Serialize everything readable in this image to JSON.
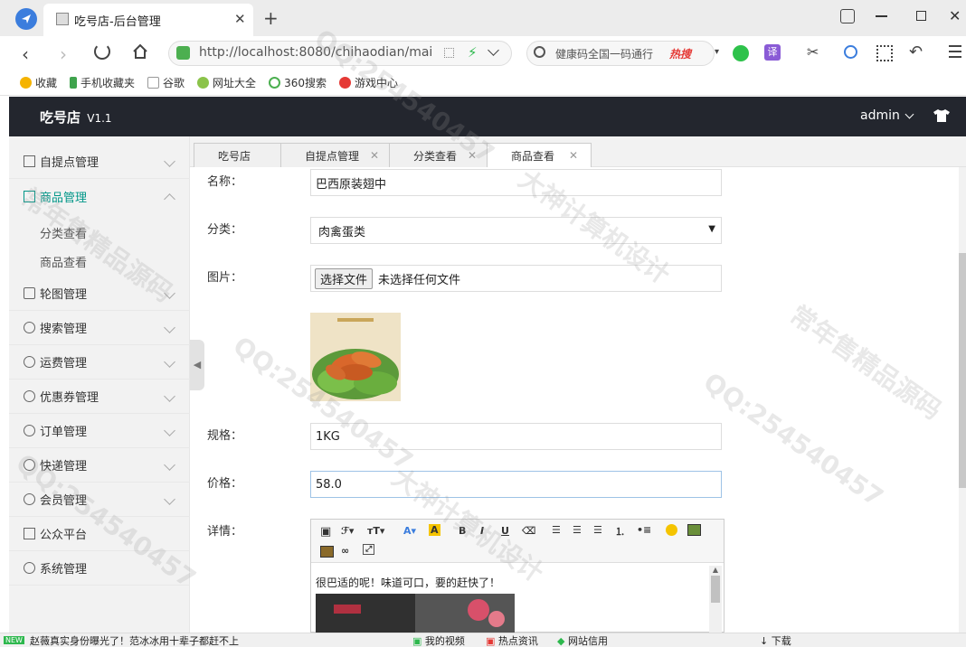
{
  "browser": {
    "tab_title": "吃号店-后台管理",
    "url": "http://localhost:8080/chihaodian/mair",
    "url_host_bold": "localhost",
    "search_placeholder": "健康码全国一码通行",
    "search_hot": "热搜",
    "bookmarks": [
      "收藏",
      "手机收藏夹",
      "谷歌",
      "网址大全",
      "360搜索",
      "游戏中心"
    ]
  },
  "app": {
    "logo": "吃号店",
    "version": "V1.1",
    "user": "admin"
  },
  "sidebar": {
    "items": [
      {
        "label": "自提点管理"
      },
      {
        "label": "商品管理"
      },
      {
        "label": "轮图管理"
      },
      {
        "label": "搜索管理"
      },
      {
        "label": "运费管理"
      },
      {
        "label": "优惠券管理"
      },
      {
        "label": "订单管理"
      },
      {
        "label": "快递管理"
      },
      {
        "label": "会员管理"
      },
      {
        "label": "公众平台"
      },
      {
        "label": "系统管理"
      }
    ],
    "sub_items": [
      "分类查看",
      "商品查看"
    ]
  },
  "page_tabs": [
    "吃号店",
    "自提点管理",
    "分类查看",
    "商品查看"
  ],
  "form": {
    "name_label": "名称：",
    "name_value": "巴西原装翅中",
    "category_label": "分类：",
    "category_value": "肉禽蛋类",
    "image_label": "图片：",
    "file_button": "选择文件",
    "file_status": "未选择任何文件",
    "spec_label": "规格：",
    "spec_value": "1KG",
    "price_label": "价格：",
    "price_value": "58.0",
    "detail_label": "详情：",
    "detail_text": "很巴适的呢！味道可口，要的赶快了！"
  },
  "statusbar": {
    "news_badge": "NEW",
    "news": "赵薇真实身份曝光了！范冰冰用十辈子都赶不上",
    "my_video": "我的视频",
    "hot_news": "热点资讯",
    "site_trust": "网站信用",
    "download": "下载"
  },
  "watermark": {
    "lines": [
      "QQ:254540457",
      "大神计算机设计",
      "常年售精品源码"
    ]
  },
  "colors": {
    "header_bg": "#23262e",
    "sidebar_active": "#009688",
    "sidebar_bg": "#f2f2f2"
  }
}
